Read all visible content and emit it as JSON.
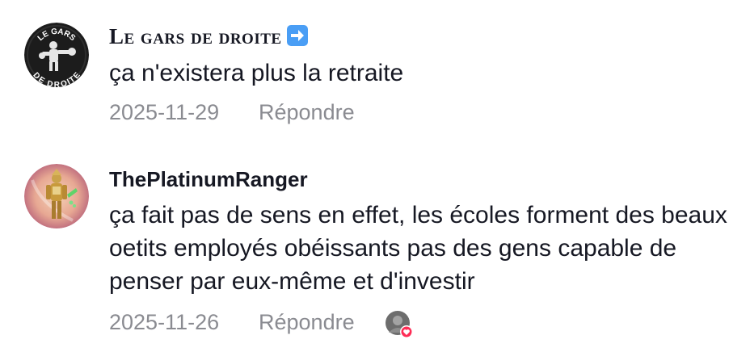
{
  "comments": [
    {
      "username": "Le gars de droite",
      "badge_icon": "right-arrow-emoji-icon",
      "avatar_logo_text_top": "LE GARS",
      "avatar_logo_text_bottom": "DE DROITE",
      "text": "ça n'existera plus la retraite",
      "date": "2025-11-29",
      "reply_label": "Répondre"
    },
    {
      "username": "ThePlatinumRanger",
      "text": "ça fait pas de sens en effet, les écoles forment des beaux oetits employés obéissants pas des gens capable de penser par eux-même et d'investir",
      "date": "2025-11-26",
      "reply_label": "Répondre",
      "liked_by_creator": true,
      "heart_color": "#fe2c55"
    }
  ]
}
